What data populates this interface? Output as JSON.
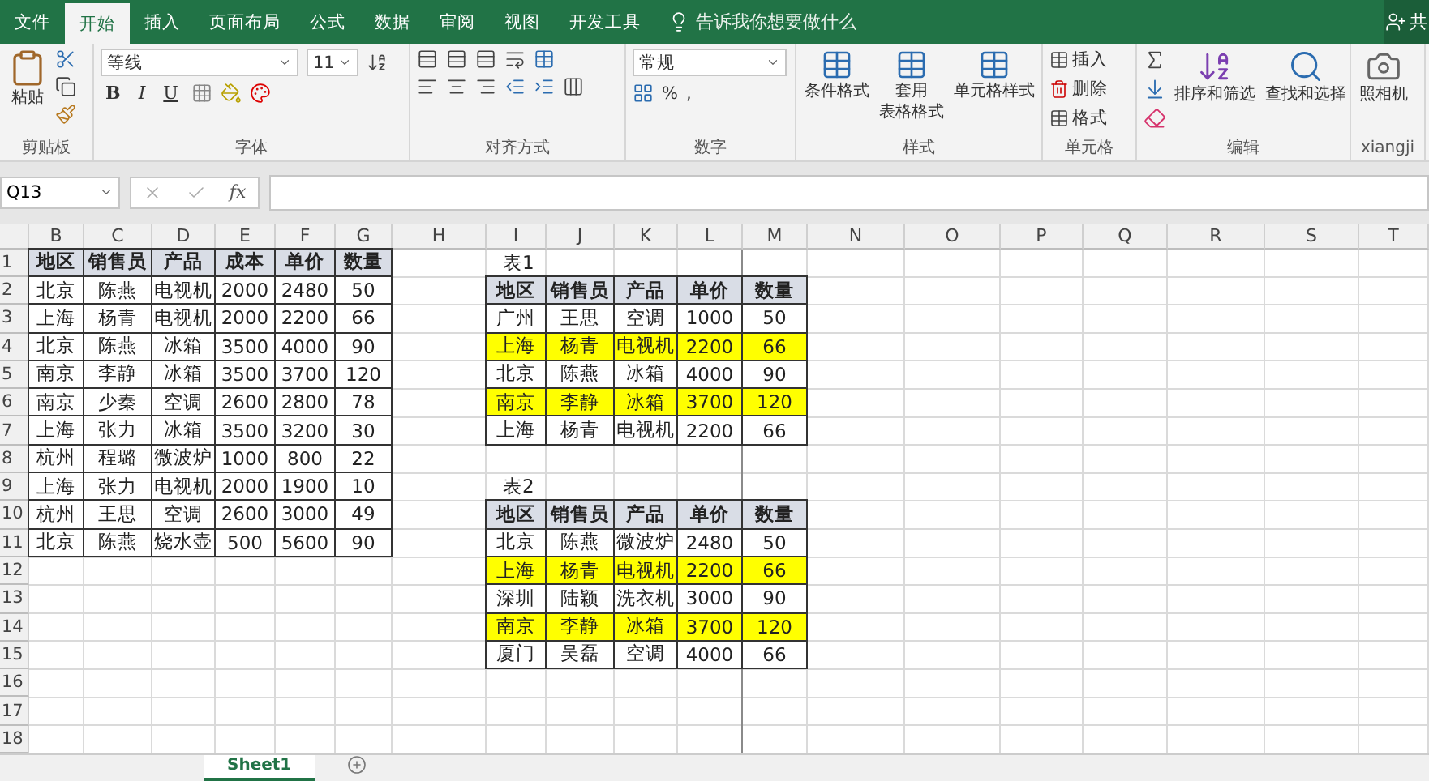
{
  "tabs": [
    {
      "label": "文件",
      "selected": false
    },
    {
      "label": "开始",
      "selected": true
    },
    {
      "label": "插入",
      "selected": false
    },
    {
      "label": "页面布局",
      "selected": false
    },
    {
      "label": "公式",
      "selected": false
    },
    {
      "label": "数据",
      "selected": false
    },
    {
      "label": "审阅",
      "selected": false
    },
    {
      "label": "视图",
      "selected": false
    },
    {
      "label": "开发工具",
      "selected": false
    }
  ],
  "tell_me": {
    "placeholder": "告诉我你想要做什么"
  },
  "share": "共",
  "ribbon": {
    "clipboard": {
      "paste": "粘贴",
      "label": "剪贴板"
    },
    "font": {
      "name": "等线",
      "size": "11",
      "bold": "B",
      "italic": "I",
      "underline": "U",
      "label": "字体"
    },
    "alignment": {
      "label": "对齐方式"
    },
    "number": {
      "format": "常规",
      "percent": "%",
      "comma": ",",
      "label": "数字"
    },
    "styles": {
      "buttons": [
        [
          "条件格式"
        ],
        [
          "套用",
          "表格格式"
        ],
        [
          "单元格样式"
        ]
      ],
      "label": "样式"
    },
    "cells": {
      "buttons": [
        "插入",
        "删除",
        "格式"
      ],
      "label": "单元格"
    },
    "editing": {
      "buttons": [
        "排序和筛选",
        "查找和选择"
      ],
      "label": "编辑"
    },
    "camera": {
      "button": "照相机",
      "label": "xiangji"
    }
  },
  "formula_bar": {
    "name_box": "Q13",
    "fx": "fx"
  },
  "columns": [
    "B",
    "C",
    "D",
    "E",
    "F",
    "G",
    "H",
    "I",
    "J",
    "K",
    "L",
    "M",
    "N",
    "O",
    "P",
    "Q",
    "R",
    "S",
    "T"
  ],
  "row_numbers": [
    "1",
    "2",
    "3",
    "4",
    "5",
    "6",
    "7",
    "8",
    "9",
    "10",
    "11",
    "12",
    "13",
    "14",
    "15",
    "16",
    "17",
    "18"
  ],
  "tables": [
    {
      "header": [
        "地区",
        "销售员",
        "产品",
        "成本",
        "单价",
        "数量"
      ],
      "rows": [
        {
          "highlighted": false,
          "cells": [
            "北京",
            "陈燕",
            "电视机",
            "2000",
            "2480",
            "50"
          ]
        },
        {
          "highlighted": false,
          "cells": [
            "上海",
            "杨青",
            "电视机",
            "2000",
            "2200",
            "66"
          ]
        },
        {
          "highlighted": false,
          "cells": [
            "北京",
            "陈燕",
            "冰箱",
            "3500",
            "4000",
            "90"
          ]
        },
        {
          "highlighted": false,
          "cells": [
            "南京",
            "李静",
            "冰箱",
            "3500",
            "3700",
            "120"
          ]
        },
        {
          "highlighted": false,
          "cells": [
            "南京",
            "少秦",
            "空调",
            "2600",
            "2800",
            "78"
          ]
        },
        {
          "highlighted": false,
          "cells": [
            "上海",
            "张力",
            "冰箱",
            "3500",
            "3200",
            "30"
          ]
        },
        {
          "highlighted": false,
          "cells": [
            "杭州",
            "程璐",
            "微波炉",
            "1000",
            "800",
            "22"
          ]
        },
        {
          "highlighted": false,
          "cells": [
            "上海",
            "张力",
            "电视机",
            "2000",
            "1900",
            "10"
          ]
        },
        {
          "highlighted": false,
          "cells": [
            "杭州",
            "王思",
            "空调",
            "2600",
            "3000",
            "49"
          ]
        },
        {
          "highlighted": false,
          "cells": [
            "北京",
            "陈燕",
            "烧水壶",
            "500",
            "5600",
            "90"
          ]
        }
      ]
    },
    {
      "title": "表1",
      "header": [
        "地区",
        "销售员",
        "产品",
        "单价",
        "数量"
      ],
      "rows": [
        {
          "highlighted": false,
          "cells": [
            "广州",
            "王思",
            "空调",
            "1000",
            "50"
          ]
        },
        {
          "highlighted": true,
          "cells": [
            "上海",
            "杨青",
            "电视机",
            "2200",
            "66"
          ]
        },
        {
          "highlighted": false,
          "cells": [
            "北京",
            "陈燕",
            "冰箱",
            "4000",
            "90"
          ]
        },
        {
          "highlighted": true,
          "cells": [
            "南京",
            "李静",
            "冰箱",
            "3700",
            "120"
          ]
        },
        {
          "highlighted": false,
          "cells": [
            "上海",
            "杨青",
            "电视机",
            "2200",
            "66"
          ]
        }
      ]
    },
    {
      "title": "表2",
      "header": [
        "地区",
        "销售员",
        "产品",
        "单价",
        "数量"
      ],
      "rows": [
        {
          "highlighted": false,
          "cells": [
            "北京",
            "陈燕",
            "微波炉",
            "2480",
            "50"
          ]
        },
        {
          "highlighted": true,
          "cells": [
            "上海",
            "杨青",
            "电视机",
            "2200",
            "66"
          ]
        },
        {
          "highlighted": false,
          "cells": [
            "深圳",
            "陆颖",
            "洗衣机",
            "3000",
            "90"
          ]
        },
        {
          "highlighted": true,
          "cells": [
            "南京",
            "李静",
            "冰箱",
            "3700",
            "120"
          ]
        },
        {
          "highlighted": false,
          "cells": [
            "厦门",
            "吴磊",
            "空调",
            "4000",
            "66"
          ]
        }
      ]
    }
  ],
  "sheet_tabs": [
    {
      "label": "Sheet1",
      "selected": true
    }
  ]
}
